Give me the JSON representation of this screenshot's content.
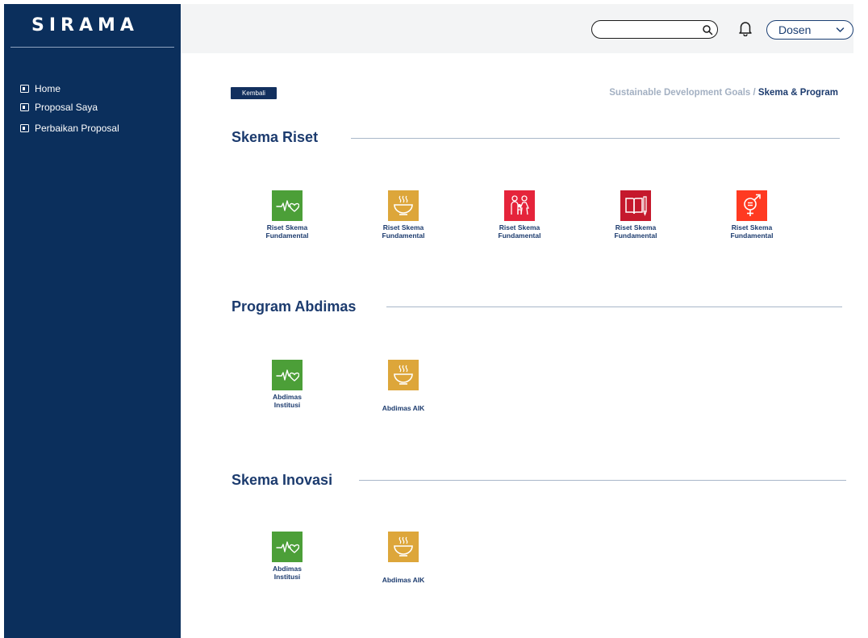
{
  "app": {
    "logo": "SIRAMA"
  },
  "sidebar": {
    "items": [
      {
        "label": "Home"
      },
      {
        "label": "Proposal Saya"
      },
      {
        "label": "Perbaikan Proposal"
      }
    ]
  },
  "header": {
    "search": {
      "value": "",
      "placeholder": ""
    },
    "role": "Dosen"
  },
  "main": {
    "back_label": "Kembali",
    "breadcrumb": {
      "parent": "Sustainable Development Goals",
      "separator": " / ",
      "current": "Skema & Program"
    },
    "sections": [
      {
        "title": "Skema Riset",
        "cards": [
          {
            "label": "Riset Skema\nFundamental",
            "icon": "health-heartbeat-icon",
            "color": "#4c9f38"
          },
          {
            "label": "Riset Skema\nFundamental",
            "icon": "food-bowl-icon",
            "color": "#dda63a"
          },
          {
            "label": "Riset Skema\nFundamental",
            "icon": "family-icon",
            "color": "#e5243b"
          },
          {
            "label": "Riset Skema\nFundamental",
            "icon": "book-pencil-icon",
            "color": "#c5192d"
          },
          {
            "label": "Riset Skema\nFundamental",
            "icon": "gender-equality-icon",
            "color": "#ff3a21"
          }
        ]
      },
      {
        "title": "Program Abdimas",
        "cards": [
          {
            "label": "Abdimas\nInstitusi",
            "icon": "health-heartbeat-icon",
            "color": "#4c9f38"
          },
          {
            "label": "Abdimas AIK",
            "icon": "food-bowl-icon",
            "color": "#dda63a"
          }
        ]
      },
      {
        "title": "Skema Inovasi",
        "cards": [
          {
            "label": "Abdimas\nInstitusi",
            "icon": "health-heartbeat-icon",
            "color": "#4c9f38"
          },
          {
            "label": "Abdimas AIK",
            "icon": "food-bowl-icon",
            "color": "#dda63a"
          }
        ]
      }
    ]
  },
  "colors": {
    "sidebar": "#0b2f5c",
    "accent": "#1c3b6e",
    "topbar": "#f3f4f5"
  }
}
